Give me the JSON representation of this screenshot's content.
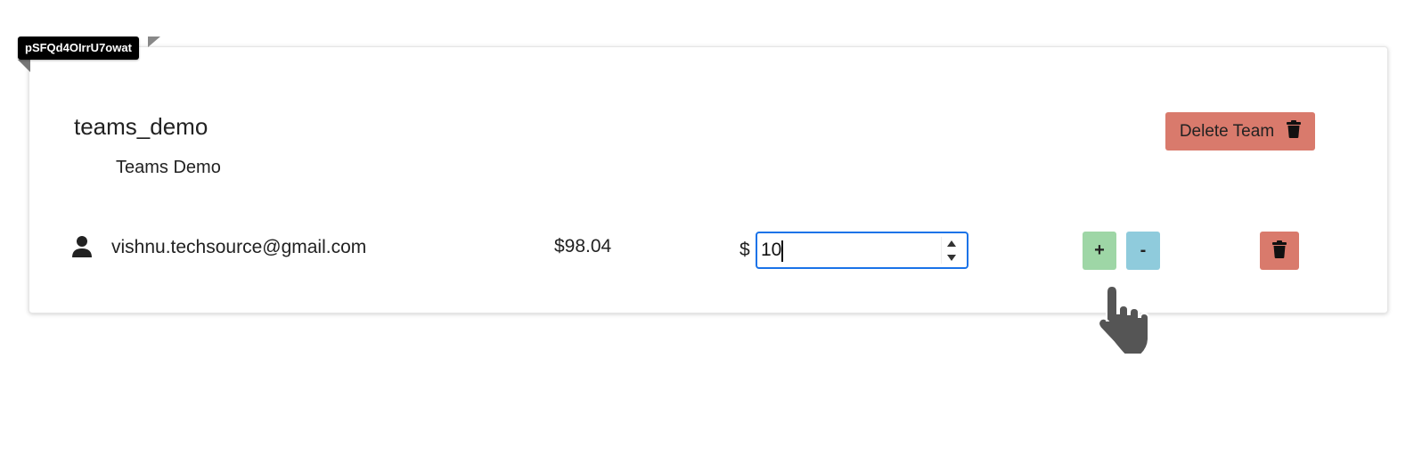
{
  "tag": {
    "label": "pSFQd4OIrrU7owat"
  },
  "team": {
    "name": "teams_demo",
    "display_name": "Teams Demo",
    "delete_label": "Delete Team"
  },
  "member": {
    "email": "vishnu.techsource@gmail.com",
    "amount": "$98.04",
    "currency_symbol": "$",
    "input_value": "10",
    "plus_label": "+",
    "minus_label": "-"
  },
  "colors": {
    "delete": "#d97a6c",
    "plus": "#9ed6a6",
    "minus": "#8fcbdc",
    "focus_border": "#1a73e8"
  },
  "icons": {
    "user": "user-icon",
    "trash": "trash-icon",
    "cursor": "hand-pointer-icon"
  }
}
